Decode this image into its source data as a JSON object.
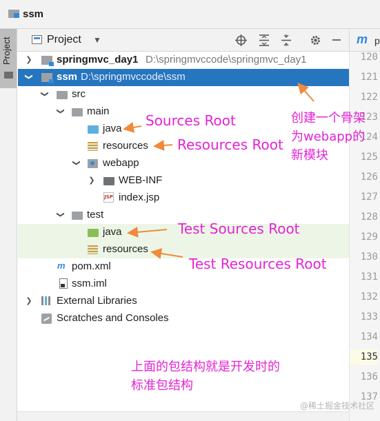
{
  "window": {
    "title": "ssm"
  },
  "sidebar": {
    "tab_label": "Project"
  },
  "project_panel": {
    "title": "Project"
  },
  "editor": {
    "tab_icon_text": "m",
    "tab_label": "p",
    "line_numbers": [
      "120",
      "121",
      "122",
      "123",
      "124",
      "125",
      "126",
      "127",
      "128",
      "129",
      "130",
      "131",
      "132",
      "133",
      "134",
      "135",
      "136",
      "137"
    ],
    "current_line": "135"
  },
  "tree": {
    "springmvc_day1": {
      "name": "springmvc_day1",
      "path": "D:\\springmvccode\\springmvc_day1"
    },
    "ssm": {
      "name": "ssm",
      "path": "D:\\springmvccode\\ssm"
    },
    "src": "src",
    "main": "main",
    "java": "java",
    "resources": "resources",
    "webapp": "webapp",
    "web_inf": "WEB-INF",
    "index_jsp": "index.jsp",
    "jsp_badge": "JSP",
    "test": "test",
    "test_java": "java",
    "test_resources": "resources",
    "pom": "pom.xml",
    "iml": "ssm.iml",
    "external_libraries": "External Libraries",
    "scratches": "Scratches and Consoles"
  },
  "annotations": {
    "sources_root": "Sources Root",
    "resources_root": "Resources Root",
    "test_sources_root": "Test Sources Root",
    "test_resources_root": "Test Resources Root",
    "skeleton_line1": "创建一个骨架",
    "skeleton_line2": "为webapp的",
    "skeleton_line3": "新模块",
    "bottom_line1": "上面的包结构就是开发时的",
    "bottom_line2": "标准包结构",
    "color": "#e423d6",
    "arrow_color": "#f08a3c"
  },
  "watermark": "@稀土掘金技术社区",
  "colors": {
    "selection": "#2675bf",
    "test_highlight": "#edf6e6"
  }
}
